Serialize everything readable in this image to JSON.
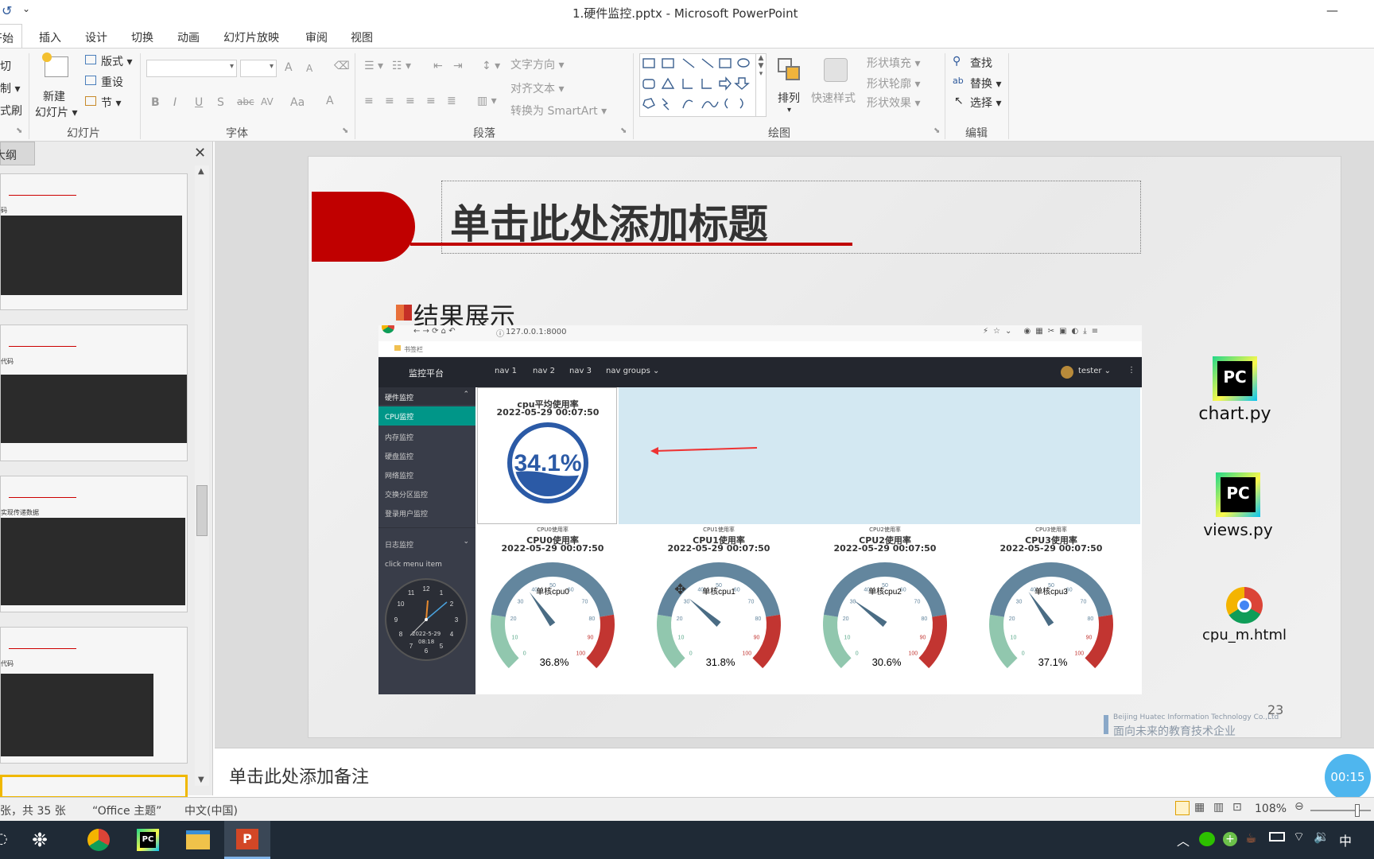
{
  "window": {
    "title": "1.硬件监控.pptx - Microsoft PowerPoint",
    "minimize": "—"
  },
  "menu": {
    "tabs": [
      "开始",
      "插入",
      "设计",
      "切换",
      "动画",
      "幻灯片放映",
      "审阅",
      "视图"
    ]
  },
  "ribbon": {
    "clipboard": {
      "cut": "切",
      "copy": "制 ▾",
      "format": "式刷"
    },
    "slides": {
      "new_slide": "新建",
      "new_slide2": "幻灯片 ▾",
      "layout": "版式 ▾",
      "reset": "重设",
      "section": "节 ▾",
      "group": "幻灯片"
    },
    "font": {
      "group": "字体",
      "grow": "A",
      "shrink": "A",
      "bold": "B",
      "italic": "I",
      "underline": "U",
      "strike": "S",
      "abc": "abc",
      "spacing": "AV",
      "case": "Aa",
      "color": "A"
    },
    "paragraph": {
      "group": "段落",
      "text_dir": "文字方向 ▾",
      "align_text": "对齐文本 ▾",
      "smartart": "转换为 SmartArt ▾"
    },
    "drawing": {
      "group": "绘图",
      "arrange": "排列",
      "quick_styles": "快速样式",
      "fill": "形状填充 ▾",
      "outline": "形状轮廓 ▾",
      "effects": "形状效果 ▾"
    },
    "editing": {
      "group": "编辑",
      "find": "查找",
      "replace": "替换 ▾",
      "select": "选择 ▾"
    }
  },
  "left_pane": {
    "tab": "大纲",
    "close": "✕",
    "thumb_labels": [
      "码",
      "代码",
      "实现传递数据",
      "代码"
    ]
  },
  "slide": {
    "title": "单击此处添加标题",
    "subtitle": "结果展示",
    "page_number": "23",
    "footer_en": "Beijing Huatec Information Technology Co.,Ltd",
    "footer_cn": "面向未来的教育技术企业",
    "browser": {
      "url": "127.0.0.1:8000",
      "bookmarks": "书签栏"
    },
    "app": {
      "brand": "监控平台",
      "nav": [
        "nav 1",
        "nav 2",
        "nav 3",
        "nav groups ⌄"
      ],
      "user": "tester ⌄",
      "sidebar_group": "硬件监控",
      "sidebar_items": [
        "CPU监控",
        "内存监控",
        "硬盘监控",
        "网络监控",
        "交换分区监控",
        "登录用户监控"
      ],
      "log_group": "日志监控",
      "click_menu": "click menu item",
      "clock_date": "2022-5-29",
      "clock_time": "08:18",
      "clock_numbers": [
        "12",
        "1",
        "2",
        "3",
        "4",
        "5",
        "6",
        "7",
        "8",
        "9",
        "10",
        "11"
      ],
      "avg": {
        "title": "cpu平均使用率",
        "time": "2022-05-29 00:07:50",
        "value": "34.1%",
        "value_num": 34.1
      },
      "gauge_scale": [
        "0",
        "10",
        "20",
        "30",
        "40",
        "50",
        "60",
        "70",
        "80",
        "90",
        "100"
      ],
      "gauges": [
        {
          "small": "CPU0使用率",
          "title": "CPU0使用率",
          "time": "2022-05-29 00:07:50",
          "name": "单核cpu0",
          "value": "36.8%",
          "value_num": 36.8
        },
        {
          "small": "CPU1使用率",
          "title": "CPU1使用率",
          "time": "2022-05-29 00:07:50",
          "name": "单核cpu1",
          "value": "31.8%",
          "value_num": 31.8
        },
        {
          "small": "CPU2使用率",
          "title": "CPU2使用率",
          "time": "2022-05-29 00:07:50",
          "name": "单核cpu2",
          "value": "30.6%",
          "value_num": 30.6
        },
        {
          "small": "CPU3使用率",
          "title": "CPU3使用率",
          "time": "2022-05-29 00:07:50",
          "name": "单核cpu3",
          "value": "37.1%",
          "value_num": 37.1
        }
      ]
    }
  },
  "desktop": {
    "icons": [
      "chart.py",
      "views.py",
      "cpu_m.html"
    ],
    "timer": "00:15"
  },
  "notes": {
    "placeholder": "单击此处添加备注"
  },
  "status": {
    "slide_info": "张，共 35 张",
    "theme": "“Office 主题”",
    "lang": "中文(中国)",
    "zoom": "108%"
  },
  "taskbar": {
    "ime": "中"
  }
}
